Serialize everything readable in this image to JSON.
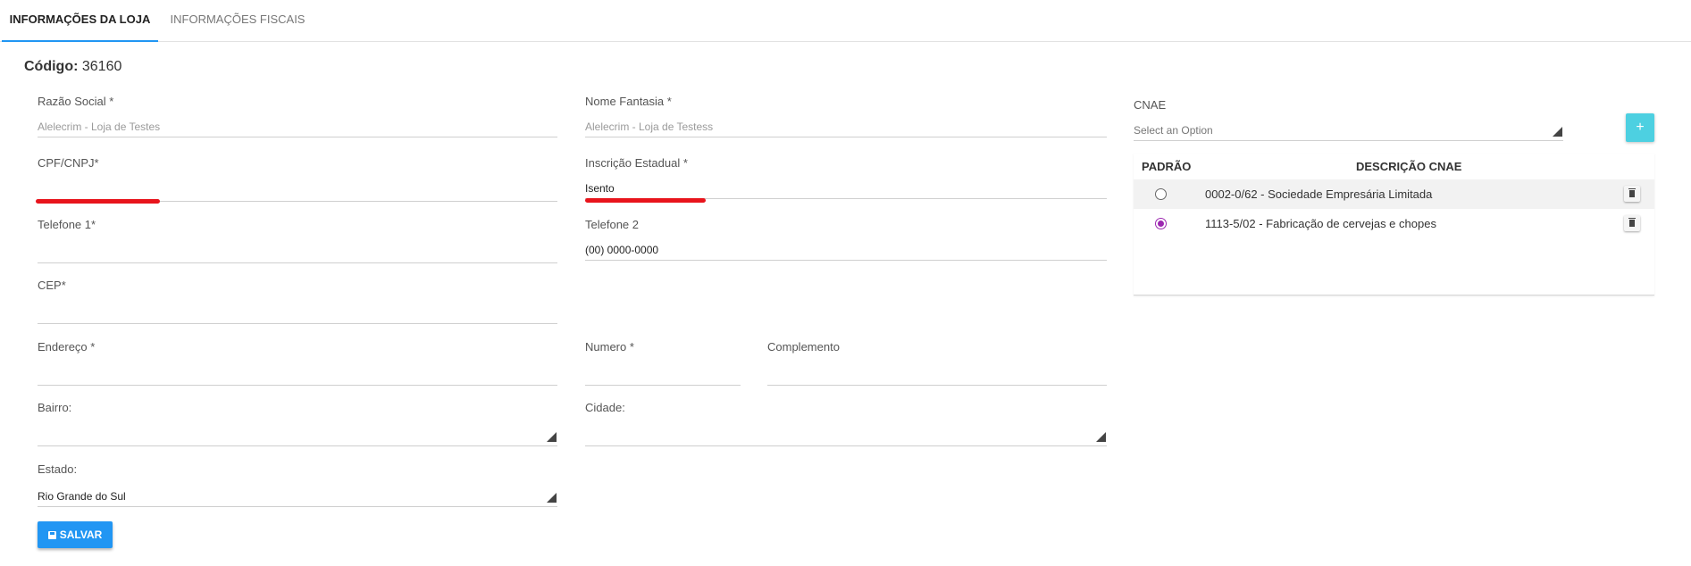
{
  "tabs": [
    {
      "label": "INFORMAÇÕES DA LOJA",
      "active": true
    },
    {
      "label": "INFORMAÇÕES FISCAIS",
      "active": false
    }
  ],
  "codigo": {
    "label": "Código:",
    "value": "36160"
  },
  "fields": {
    "razao_social": {
      "label": "Razão Social *",
      "value": "",
      "placeholder": "Alelecrim - Loja de Testes"
    },
    "nome_fantasia": {
      "label": "Nome Fantasia *",
      "value": "",
      "placeholder": "Alelecrim - Loja de Testess"
    },
    "cpf_cnpj": {
      "label": "CPF/CNPJ*",
      "value": "",
      "placeholder": ""
    },
    "inscricao_estadual": {
      "label": "Inscrição Estadual *",
      "value": "Isento",
      "placeholder": ""
    },
    "telefone1": {
      "label": "Telefone 1*",
      "value": "",
      "placeholder": ""
    },
    "telefone2": {
      "label": "Telefone 2",
      "value": "(00) 0000-0000",
      "placeholder": ""
    },
    "cep": {
      "label": "CEP*",
      "value": "",
      "placeholder": ""
    },
    "endereco": {
      "label": "Endereço *",
      "value": "",
      "placeholder": ""
    },
    "numero": {
      "label": "Numero *",
      "value": "",
      "placeholder": ""
    },
    "complemento": {
      "label": "Complemento",
      "value": "",
      "placeholder": ""
    },
    "bairro": {
      "label": "Bairro:",
      "value": ""
    },
    "cidade": {
      "label": "Cidade:",
      "value": ""
    },
    "estado": {
      "label": "Estado:",
      "value": "Rio Grande do Sul"
    }
  },
  "cnae": {
    "label": "CNAE",
    "select_placeholder": "Select an Option",
    "add_label": "+",
    "headers": {
      "padrao": "PADRÃO",
      "descricao": "DESCRIÇÃO CNAE"
    },
    "rows": [
      {
        "descricao": "0002-0/62 - Sociedade Empresária Limitada",
        "padrao": false
      },
      {
        "descricao": "1113-5/02 - Fabricação de cervejas e chopes",
        "padrao": true
      }
    ]
  },
  "save_label": "SALVAR",
  "colors": {
    "primary": "#2196f3",
    "accent_add": "#4dd0e1",
    "radio_checked": "#9c27b0",
    "annotation_red": "#e8141c"
  }
}
